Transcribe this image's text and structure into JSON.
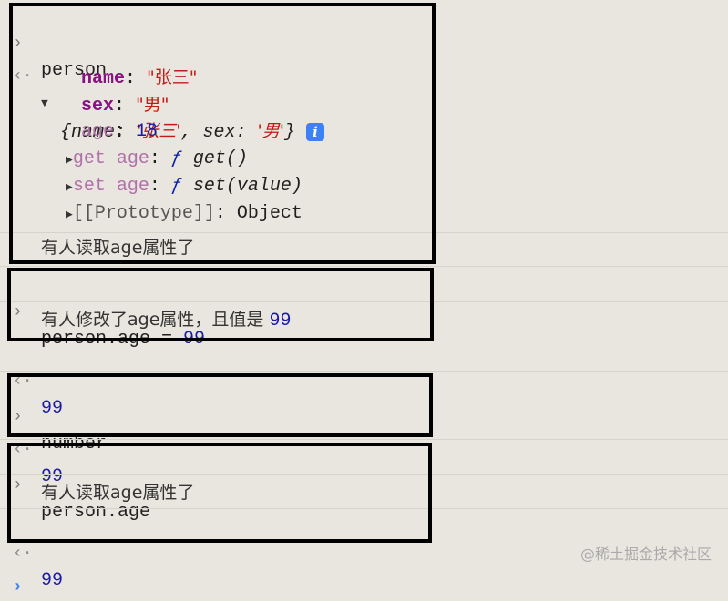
{
  "console": {
    "entry1": {
      "input": "person",
      "preview": {
        "open": "{",
        "k1": "name",
        "v1": "'张三'",
        "k2": "sex",
        "v2": "'男'",
        "close": "}"
      },
      "props": [
        {
          "key": "name",
          "value": "\"张三\""
        },
        {
          "key": "sex",
          "value": "\"男\""
        },
        {
          "key": "age",
          "value": "18"
        }
      ],
      "getter": {
        "label": "get age",
        "f": "ƒ",
        "sig": "get()"
      },
      "setter": {
        "label": "set age",
        "f": "ƒ",
        "sig": "set(value)"
      },
      "prototype": {
        "label": "[[Prototype]]",
        "value": "Object"
      },
      "log": "有人读取age属性了"
    },
    "entry2": {
      "input_prefix": "person.age = ",
      "input_value": "99",
      "log_text": "有人修改了age属性，且值是 ",
      "log_value": "99",
      "result": "99"
    },
    "entry3": {
      "input": "number",
      "result": "99"
    },
    "entry4": {
      "input": "person.age",
      "log": "有人读取age属性了",
      "result": "99"
    }
  },
  "icons": {
    "input": "chevron-right-icon",
    "output": "return-arrow-icon",
    "info": "info-icon"
  },
  "watermark": "@稀土掘金技术社区",
  "glyphs": {
    "prompt": "›",
    "ret": "‹·",
    "down": "▼",
    "right": "▶",
    "colon": ": ",
    "info": "i"
  }
}
